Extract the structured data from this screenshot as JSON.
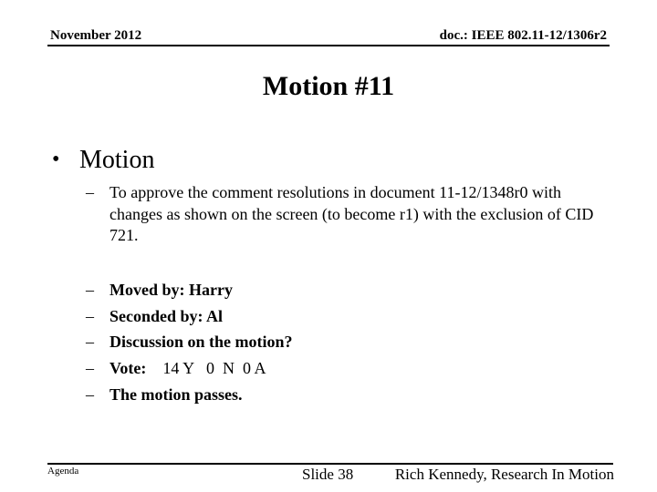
{
  "header": {
    "date": "November 2012",
    "doc_id": "doc.: IEEE 802.11-12/1306r2"
  },
  "title": "Motion #11",
  "main": {
    "bullet": "Motion",
    "bullet_symbol": "•",
    "dash_symbol": "–",
    "description": "To approve the comment resolutions in document 11-12/1348r0 with changes as shown on the screen (to become r1) with the exclusion of CID 721.",
    "items": [
      {
        "label": "Moved by: Harry",
        "value": ""
      },
      {
        "label": "Seconded by: Al",
        "value": ""
      },
      {
        "label": "Discussion on the motion?",
        "value": ""
      },
      {
        "label": "Vote:",
        "value": "    14 Y   0  N  0 A"
      },
      {
        "label": "The motion passes.",
        "value": ""
      }
    ]
  },
  "footer": {
    "section": "Agenda",
    "slide": "Slide 38",
    "author": "Rich Kennedy, Research In Motion"
  }
}
